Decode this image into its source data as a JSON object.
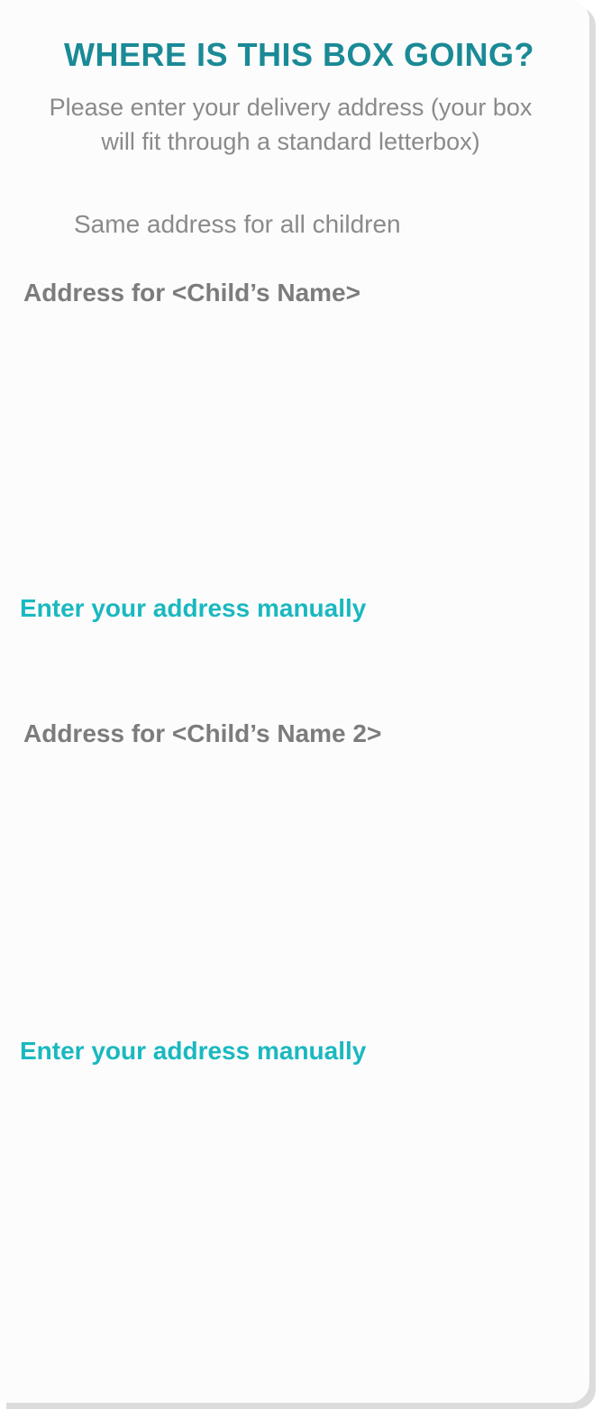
{
  "header": {
    "title": "WHERE IS THIS BOX GOING?",
    "subtitle": "Please enter your delivery address (your box will fit through a standard letterbox)"
  },
  "options": {
    "same_address_label": "Same address for all children"
  },
  "children": [
    {
      "address_label": "Address for <Child’s Name>",
      "manual_link": "Enter your address manually"
    },
    {
      "address_label": "Address for <Child’s Name 2>",
      "manual_link": "Enter your address manually"
    }
  ],
  "colors": {
    "title": "#1a8a96",
    "link": "#1ab8c0",
    "body_text": "#8a8a8a",
    "label_text": "#7c7c7c",
    "card_background": "#fcfcfc",
    "card_shadow": "#dcdcdc"
  }
}
